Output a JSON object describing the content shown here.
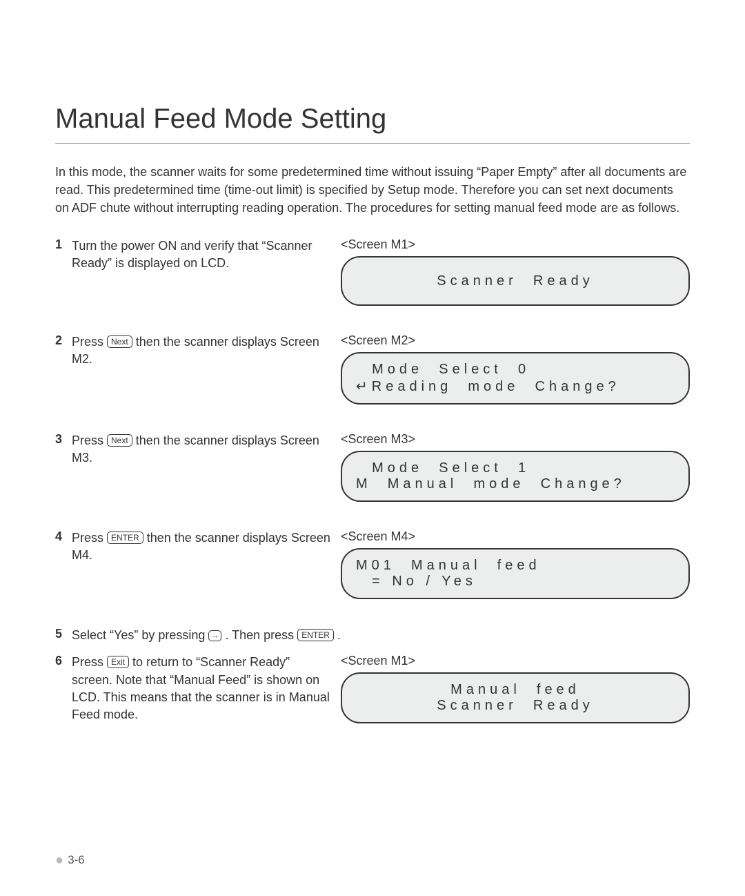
{
  "title": "Manual Feed Mode Setting",
  "intro": "In this mode, the scanner waits for some predetermined time without issuing “Paper Empty” after all documents are read. This predetermined time (time-out limit) is specified by Setup mode. Therefore you can set next documents on ADF chute without interrupting reading operation. The procedures for setting manual feed mode are as follows.",
  "buttons": {
    "next": "Next",
    "enter": "ENTER",
    "exit": "Exit",
    "right": "→"
  },
  "steps": [
    {
      "n": "1",
      "pre": "Turn the power ON and verify that “Scanner Ready” is displayed on LCD.",
      "screen": "<Screen M1>",
      "lcd": {
        "l1": "",
        "l2": "Scanner  Ready",
        "center": true
      }
    },
    {
      "n": "2",
      "pre": "Press ",
      "btn": "next",
      "post": " then the scanner displays Screen M2.",
      "screen": "<Screen M2>",
      "lcd": {
        "l1": "  Mode  Select  0",
        "l2": "↵Reading  mode  Change?",
        "center": false
      }
    },
    {
      "n": "3",
      "pre": "Press ",
      "btn": "next",
      "post": " then the scanner displays Screen M3.",
      "screen": "<Screen M3>",
      "lcd": {
        "l1": "  Mode  Select  1",
        "l2": "M  Manual  mode  Change?",
        "center": false
      }
    },
    {
      "n": "4",
      "pre": "Press ",
      "btn": "enter",
      "post": " then the scanner displays Screen M4.",
      "screen": "<Screen M4>",
      "lcd": {
        "l1": "M01  Manual  feed",
        "l2": "  = No / Yes",
        "center": false
      }
    },
    {
      "n": "5",
      "pre": "Select “Yes” by pressing ",
      "btn": "right",
      "post": ". Then press ",
      "btn2": "enter",
      "post2": "."
    },
    {
      "n": "6",
      "pre": "Press ",
      "btn": "exit",
      "post": " to return to “Scanner Ready” screen. Note that “Manual Feed” is shown on LCD. This means that the scanner is in Manual Feed mode.",
      "screen": "<Screen M1>",
      "lcd": {
        "l1": "Manual  feed",
        "l2": "Scanner  Ready",
        "center": true
      }
    }
  ],
  "page_number": "3-6"
}
